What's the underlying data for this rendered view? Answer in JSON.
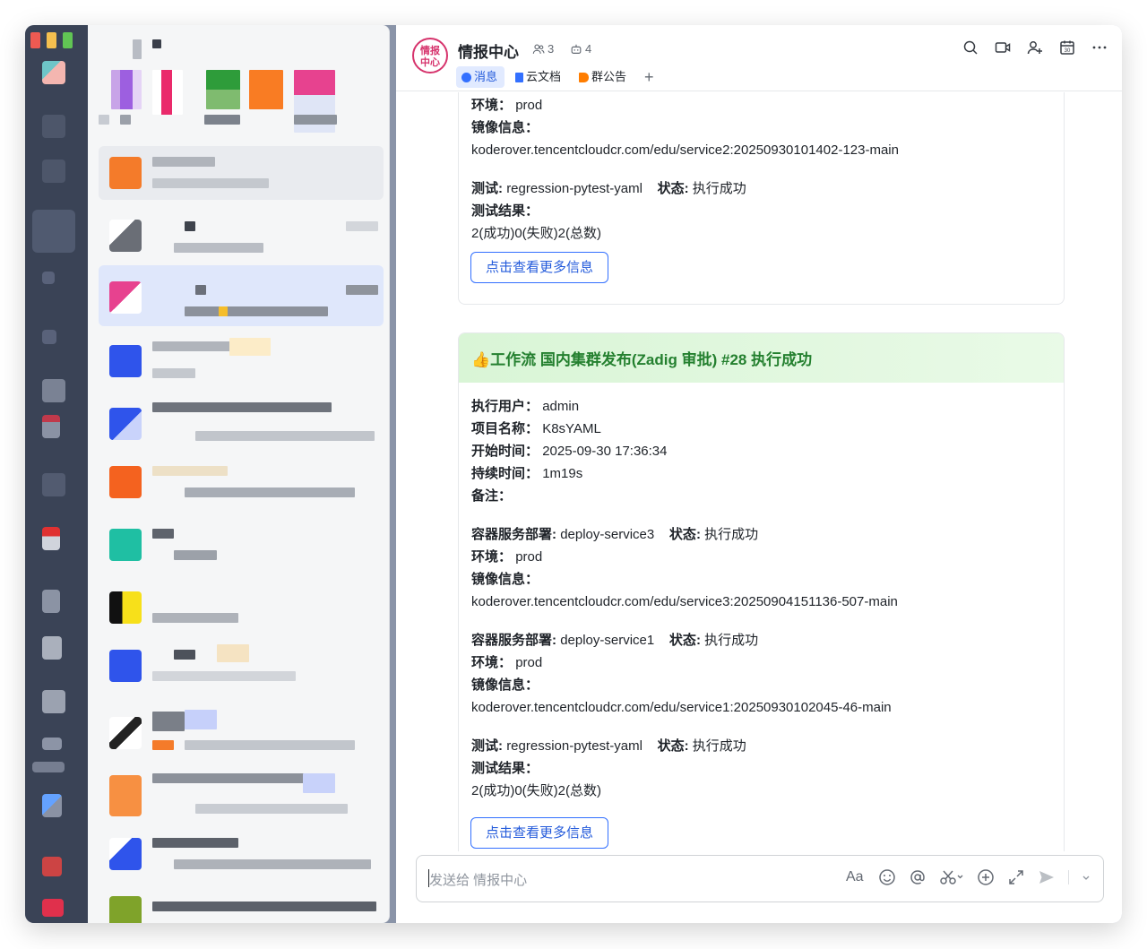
{
  "group": {
    "avatar_text": "情报\n中心",
    "name": "情报中心",
    "member_count": "3",
    "bot_count": "4"
  },
  "tabs": [
    {
      "label": "消息",
      "color": "#3370ff"
    },
    {
      "label": "云文档",
      "color": "#3370ff"
    },
    {
      "label": "群公告",
      "color": "#ff7d00"
    }
  ],
  "card_top": {
    "env_label": "环境",
    "env_value": "prod",
    "image_label": "镜像信息",
    "image_value": "koderover.tencentcloudcr.com/edu/service2:20250930101402-123-main",
    "test_label": "测试",
    "test_value": "regression-pytest-yaml",
    "state_label": "状态",
    "state_value": "执行成功",
    "result_label": "测试结果",
    "result_value": "2(成功)0(失败)2(总数)",
    "button": "点击查看更多信息"
  },
  "card_main": {
    "title": "👍工作流 国内集群发布(Zadig 审批) #28 执行成功",
    "user_label": "执行用户",
    "user_value": "admin",
    "project_label": "项目名称",
    "project_value": "K8sYAML",
    "start_label": "开始时间",
    "start_value": "2025-09-30 17:36:34",
    "duration_label": "持续时间",
    "duration_value": "1m19s",
    "note_label": "备注",
    "deploys": [
      {
        "deploy_label": "容器服务部署",
        "deploy_value": "deploy-service3",
        "state_label": "状态",
        "state_value": "执行成功",
        "env_label": "环境",
        "env_value": "prod",
        "image_label": "镜像信息",
        "image_value": "koderover.tencentcloudcr.com/edu/service3:20250904151136-507-main"
      },
      {
        "deploy_label": "容器服务部署",
        "deploy_value": "deploy-service1",
        "state_label": "状态",
        "state_value": "执行成功",
        "env_label": "环境",
        "env_value": "prod",
        "image_label": "镜像信息",
        "image_value": "koderover.tencentcloudcr.com/edu/service1:20250930102045-46-main"
      }
    ],
    "test_label": "测试",
    "test_value": "regression-pytest-yaml",
    "state_label": "状态",
    "state_value": "执行成功",
    "result_label": "测试结果",
    "result_value": "2(成功)0(失败)2(总数)",
    "button": "点击查看更多信息"
  },
  "composer": {
    "placeholder": "发送给 情报中心",
    "font_button": "Aa"
  },
  "colors": {
    "accent": "#3370ff",
    "success_header": "#d9f5d6",
    "success_text": "#24802f",
    "group_avatar": "#d6336c"
  }
}
